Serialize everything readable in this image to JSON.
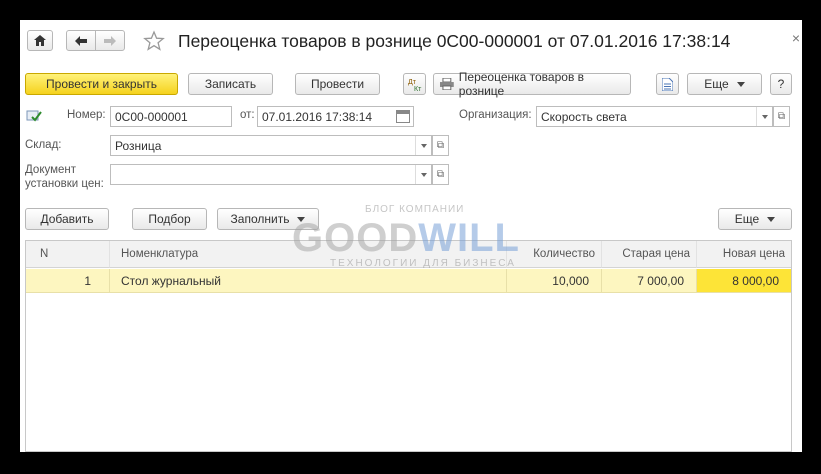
{
  "window": {
    "close_glyph": "×"
  },
  "nav": {
    "home_icon": "home-icon",
    "back_icon": "arrow-left-icon",
    "forward_icon": "arrow-right-icon",
    "favorite_icon": "star-icon"
  },
  "title": "Переоценка товаров в рознице 0С00-000001 от 07.01.2016 17:38:14",
  "toolbar": {
    "post_close": "Провести и закрыть",
    "save": "Записать",
    "post": "Провести",
    "print_form": "Переоценка товаров в рознице",
    "more": "Еще",
    "help": "?"
  },
  "form": {
    "number_label": "Номер:",
    "number_value": "0С00-000001",
    "date_label": "от:",
    "date_value": "07.01.2016 17:38:14",
    "org_label": "Организация:",
    "org_value": "Скорость света",
    "warehouse_label": "Склад:",
    "warehouse_value": "Розница",
    "pricedoc_label_1": "Документ",
    "pricedoc_label_2": "установки цен:",
    "pricedoc_value": ""
  },
  "table_toolbar": {
    "add": "Добавить",
    "select": "Подбор",
    "fill": "Заполнить",
    "more": "Еще"
  },
  "table": {
    "columns": [
      "N",
      "Номенклатура",
      "Количество",
      "Старая цена",
      "Новая цена"
    ],
    "rows": [
      {
        "n": "1",
        "item": "Стол журнальный",
        "qty": "10,000",
        "old_price": "7 000,00",
        "new_price": "8 000,00"
      }
    ]
  },
  "watermark": {
    "top": "БЛОГ КОМПАНИИ",
    "brand_a": "GOOD",
    "brand_b": "WILL",
    "bottom": "ТЕХНОЛОГИИ ДЛЯ БИЗНЕСА"
  },
  "colors": {
    "primary_button": "#f5d21e",
    "row_highlight": "#fdf6c0",
    "active_cell": "#fde437"
  }
}
